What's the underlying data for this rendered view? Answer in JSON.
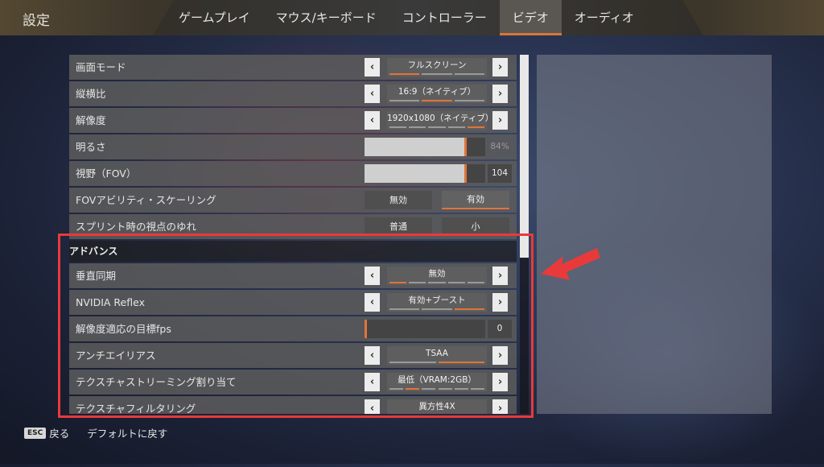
{
  "header": {
    "title": "設定",
    "tabs": [
      {
        "label": "ゲームプレイ",
        "active": false
      },
      {
        "label": "マウス/キーボード",
        "active": false
      },
      {
        "label": "コントローラー",
        "active": false
      },
      {
        "label": "ビデオ",
        "active": true
      },
      {
        "label": "オーディオ",
        "active": false
      }
    ]
  },
  "settings": {
    "display_mode": {
      "label": "画面モード",
      "value": "フルスクリーン",
      "segment_count": 3,
      "selected_segment": 1
    },
    "aspect_ratio": {
      "label": "縦横比",
      "value": "16:9（ネイティブ）",
      "segment_count": 3,
      "selected_segment": 2
    },
    "resolution": {
      "label": "解像度",
      "value": "1920x1080（ネイティブ）",
      "segment_count": 5,
      "selected_segment": 5
    },
    "brightness": {
      "label": "明るさ",
      "value_text": "84%",
      "level_percent": 84
    },
    "fov": {
      "label": "視野（FOV）",
      "value_text": "104",
      "level_percent": 84
    },
    "fov_ability_scaling": {
      "label": "FOVアビリティ・スケーリング",
      "options": [
        "無効",
        "有効"
      ],
      "selected": "有効"
    },
    "sprint_view_shake": {
      "label": "スプリント時の視点のゆれ",
      "options": [
        "普通",
        "小"
      ],
      "selected": null
    },
    "advanced_header": "アドバンス",
    "vsync": {
      "label": "垂直同期",
      "value": "無効",
      "segment_count": 5,
      "selected_segment": 1
    },
    "nvidia_reflex": {
      "label": "NVIDIA Reflex",
      "value": "有効+ブースト",
      "segment_count": 3,
      "selected_segment": 3
    },
    "adaptive_res_fps": {
      "label": "解像度適応の目標fps",
      "value_text": "0",
      "level_percent": 0
    },
    "anti_aliasing": {
      "label": "アンチエイリアス",
      "value": "TSAA",
      "segment_count": 2,
      "selected_segment": 2
    },
    "texture_streaming": {
      "label": "テクスチャストリーミング割り当て",
      "value": "最低（VRAM:2GB）",
      "segment_count": 6,
      "selected_segment": 2
    },
    "texture_filtering": {
      "label": "テクスチャフィルタリング",
      "value": "異方性4X",
      "segment_count": 5,
      "selected_segment": 0
    }
  },
  "footer": {
    "esc_key": "ESC",
    "back_label": "戻る",
    "reset_label": "デフォルトに戻す"
  },
  "colors": {
    "accent": "#e0743a",
    "highlight_annotation": "#e83a3a"
  }
}
